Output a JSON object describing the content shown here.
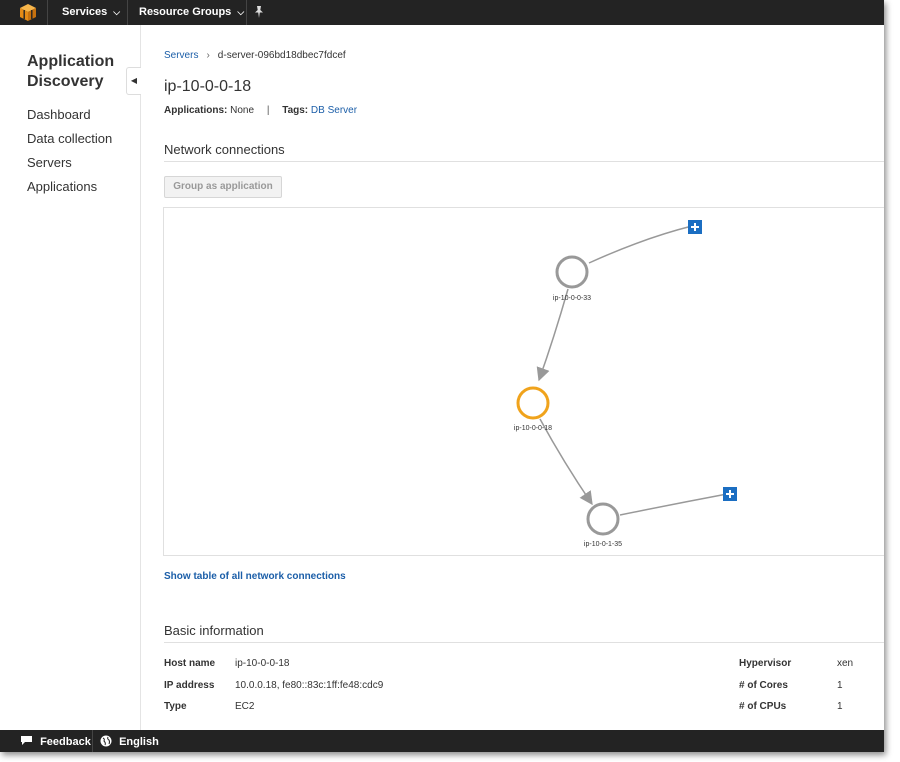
{
  "nav": {
    "services_label": "Services",
    "resource_groups_label": "Resource Groups"
  },
  "sidebar": {
    "title": "Application Discovery",
    "items": [
      {
        "label": "Dashboard"
      },
      {
        "label": "Data collection"
      },
      {
        "label": "Servers"
      },
      {
        "label": "Applications"
      }
    ]
  },
  "breadcrumb": {
    "parent": "Servers",
    "current": "d-server-096bd18dbec7fdcef"
  },
  "server": {
    "name": "ip-10-0-0-18",
    "applications_label": "Applications:",
    "applications_value": "None",
    "tags_label": "Tags:",
    "tags_value": "DB Server"
  },
  "network": {
    "section_title": "Network connections",
    "group_button_label": "Group as application",
    "show_table_link": "Show table of all network connections",
    "nodes": [
      {
        "label": "ip-10-0-0-33",
        "selected": false
      },
      {
        "label": "ip-10-0-0-18",
        "selected": true
      },
      {
        "label": "ip-10-0-1-35",
        "selected": false
      }
    ],
    "colors": {
      "node": "#999999",
      "selected_node": "#f0a31c",
      "edge": "#999999",
      "expand": "#1b6ec2"
    }
  },
  "basic_info": {
    "section_title": "Basic information",
    "left": [
      {
        "label": "Host name",
        "value": "ip-10-0-0-18"
      },
      {
        "label": "IP address",
        "value": "10.0.0.18, fe80::83c:1ff:fe48:cdc9"
      },
      {
        "label": "Type",
        "value": "EC2"
      }
    ],
    "right": [
      {
        "label": "Hypervisor",
        "value": "xen"
      },
      {
        "label": "# of Cores",
        "value": "1"
      },
      {
        "label": "# of CPUs",
        "value": "1"
      }
    ]
  },
  "footer": {
    "feedback_label": "Feedback",
    "language_label": "English"
  },
  "colors": {
    "topbar": "#232323",
    "link": "#1b5ea8",
    "aws_orange": "#f0a31c"
  }
}
